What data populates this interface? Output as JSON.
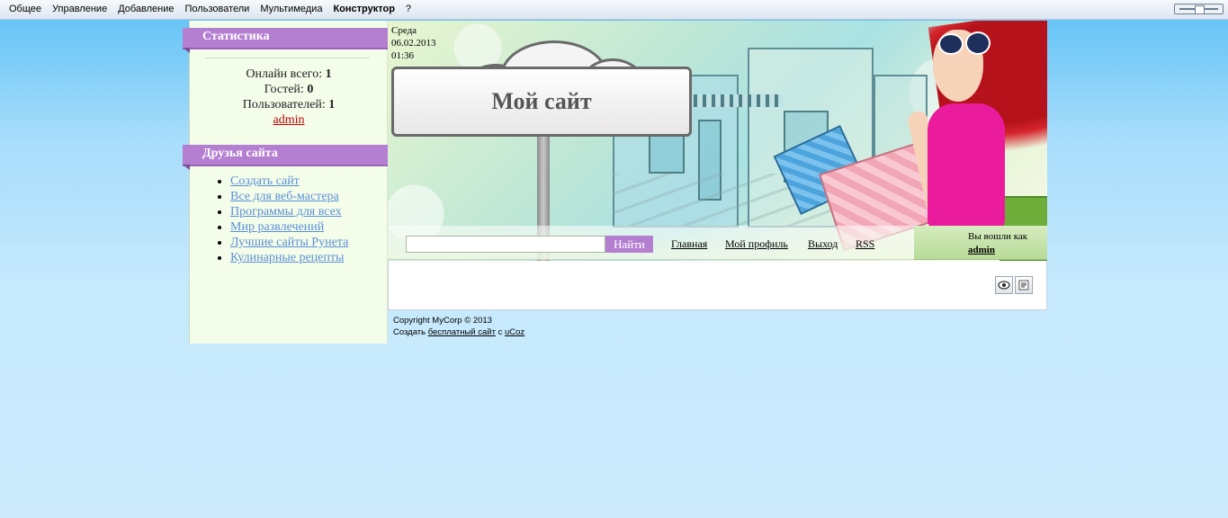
{
  "admin_bar": {
    "menu": [
      "Общее",
      "Управление",
      "Добавление",
      "Пользователи",
      "Мультимедиа",
      "Конструктор",
      "?"
    ]
  },
  "sidebar": {
    "stats": {
      "title": "Статистика",
      "online_label": "Онлайн всего:",
      "online_value": "1",
      "guests_label": "Гостей:",
      "guests_value": "0",
      "users_label": "Пользователей:",
      "users_value": "1",
      "user_link": "admin"
    },
    "friends": {
      "title": "Друзья сайта",
      "links": [
        "Создать сайт",
        "Все для веб-мастера",
        "Программы для всех",
        "Мир развлечений",
        "Лучшие сайты Рунета",
        "Кулинарные рецепты"
      ]
    }
  },
  "header": {
    "day": "Среда",
    "date": "06.02.2013",
    "time": "01:36",
    "site_title": "Мой сайт"
  },
  "nav": {
    "search_value": "",
    "search_button": "Найти",
    "links": [
      "Главная",
      "Мой профиль",
      "Выход",
      "RSS"
    ]
  },
  "login": {
    "label": "Вы вошли как",
    "user": "admin"
  },
  "footer": {
    "copyright": "Copyright MyCorp © 2013",
    "create_prefix": "Создать",
    "free_site_link": "бесплатный сайт",
    "with": "с",
    "ucoz_link": "uCoz"
  },
  "colors": {
    "accent": "#b47fd1",
    "sidebar_bg": "#f4fdea",
    "link": "#5b8fd6",
    "user_link": "#c00000"
  }
}
